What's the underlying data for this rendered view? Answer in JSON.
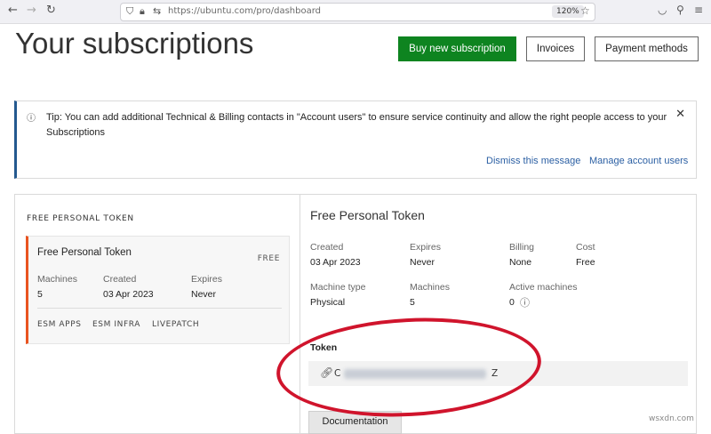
{
  "browser": {
    "url": "https://ubuntu.com/pro/dashboard",
    "zoom": "120%"
  },
  "header": {
    "title": "Your subscriptions",
    "buy_label": "Buy new subscription",
    "invoices_label": "Invoices",
    "payment_label": "Payment methods"
  },
  "notice": {
    "text": "Tip: You can add additional Technical & Billing contacts in \"Account users\" to ensure service continuity and allow the right people access to your Subscriptions",
    "dismiss": "Dismiss this message",
    "manage": "Manage account users"
  },
  "list": {
    "section_label": "FREE PERSONAL TOKEN",
    "item": {
      "name": "Free Personal Token",
      "tag": "FREE",
      "machines_label": "Machines",
      "machines": "5",
      "created_label": "Created",
      "created": "03 Apr 2023",
      "expires_label": "Expires",
      "expires": "Never",
      "features": [
        "ESM APPS",
        "ESM INFRA",
        "LIVEPATCH"
      ]
    }
  },
  "details": {
    "title": "Free Personal Token",
    "fields": [
      {
        "label": "Created",
        "value": "03 Apr 2023"
      },
      {
        "label": "Expires",
        "value": "Never"
      },
      {
        "label": "Billing",
        "value": "None"
      },
      {
        "label": "Cost",
        "value": "Free"
      },
      {
        "label": "Machine type",
        "value": "Physical"
      },
      {
        "label": "Machines",
        "value": "5"
      },
      {
        "label": "Active machines",
        "value": "0"
      }
    ],
    "token_label": "Token",
    "token_start": "C",
    "token_end": "Z",
    "doc_button": "Documentation"
  },
  "watermark": "wsxdn.com",
  "annotation_color": "#d0142c"
}
